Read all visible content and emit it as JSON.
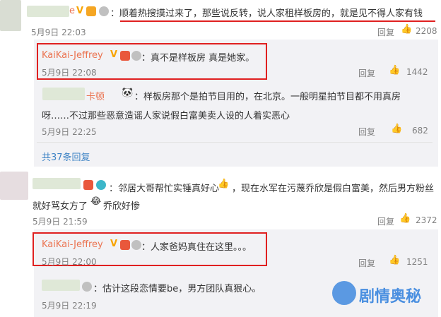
{
  "c1": {
    "nick": "e",
    "text": "：顺着热搜摸过来了，那些说反转，说人家租样板房的，就是见不得人家有钱",
    "time": "5月9日 22:03",
    "reply": "回复",
    "likes": "2208"
  },
  "r1": {
    "nick": "KaiKai-Jeffrey",
    "text": "：真不是样板房 真是她家。",
    "time": "5月9日 22:08",
    "reply": "回复",
    "likes": "1442"
  },
  "r2": {
    "nick": "卡顿",
    "text": "：样板房那个是拍节目用的，在北京。一般明星拍节目都不用真房",
    "text2": "呀……不过那些恶意造谣人家说假白富美卖人设的人着实恶心",
    "time": "5月9日 22:25",
    "reply": "回复",
    "likes": "682"
  },
  "more": "共37条回复",
  "c2": {
    "text": "：邻居大哥帮忙实锤真好心",
    "text_b": "，现在水军在污蔑乔欣是假白富美，然后男方粉丝",
    "text2": "就好骂女方了",
    "text2b": "乔欣好惨",
    "time": "5月9日 21:59",
    "reply": "回复",
    "likes": "2372"
  },
  "r3": {
    "nick": "KaiKai-Jeffrey",
    "text": "：人家爸妈真住在这里。。。",
    "time": "5月9日 22:00",
    "reply": "回复",
    "likes": "1251"
  },
  "r4": {
    "text": "：估计这段恋情要be，男方团队真狠心。",
    "time": "5月9日 22:19"
  },
  "watermark": "剧情奥秘",
  "colors": {
    "nick": "#eb7350",
    "red": "#e02020",
    "link": "#3f84c5"
  }
}
